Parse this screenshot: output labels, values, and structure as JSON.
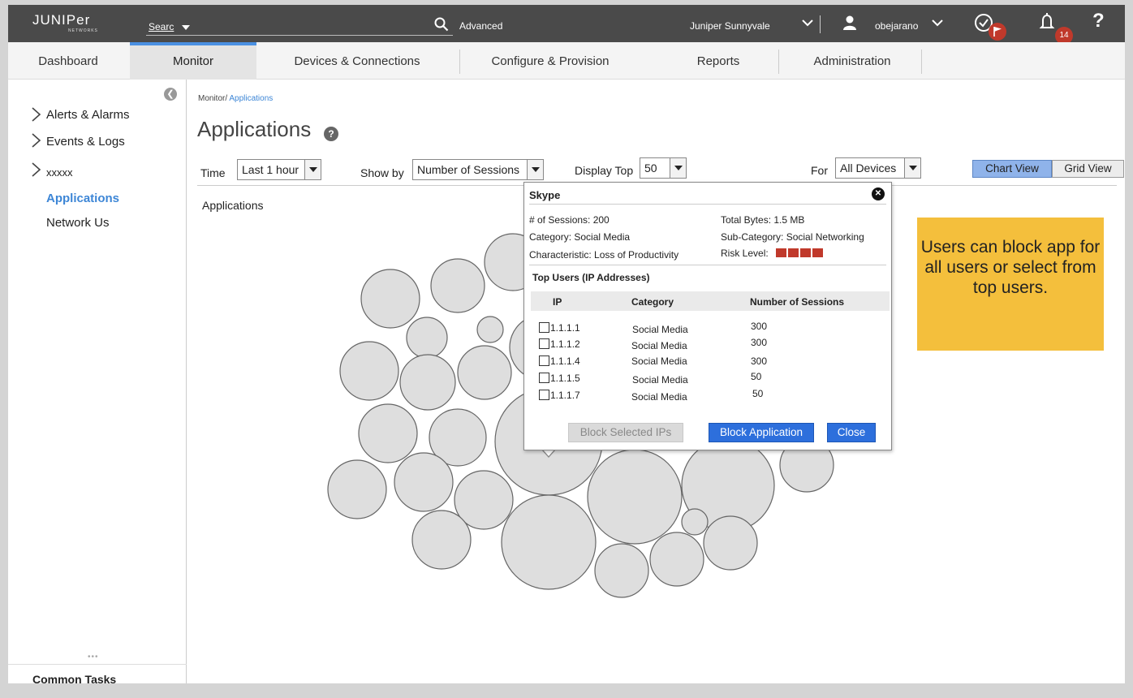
{
  "brand": {
    "logo_text": "JUNIPer",
    "logo_sub": "NETWORKS"
  },
  "topbar": {
    "search_label": "Searc",
    "advanced_label": "Advanced",
    "location": "Juniper Sunnyvale",
    "username": "obejarano",
    "notifications_count": "14",
    "help_label": "?"
  },
  "nav": {
    "items": [
      {
        "label": "Dashboard"
      },
      {
        "label": "Monitor"
      },
      {
        "label": "Devices & Connections"
      },
      {
        "label": "Configure & Provision"
      },
      {
        "label": "Reports"
      },
      {
        "label": "Administration"
      }
    ],
    "active": "Monitor"
  },
  "sidebar": {
    "items": [
      {
        "label": "Alerts & Alarms"
      },
      {
        "label": "Events & Logs"
      },
      {
        "label": "xxxxx"
      },
      {
        "label": "Applications"
      },
      {
        "label": "Network Us"
      }
    ],
    "common_tasks": "Common Tasks"
  },
  "main": {
    "breadcrumb_root": "Monitor/",
    "breadcrumb_current": "Applications",
    "title": "Applications",
    "apps_label": "Applications",
    "filters": {
      "time_label": "Time",
      "time_value": "Last 1 hour",
      "showby_label": "Show by",
      "showby_value": "Number of Sessions",
      "top_label": "Display Top",
      "top_value": "50",
      "for_label": "For",
      "for_value": "All Devices"
    },
    "chart_view": "Chart View",
    "grid_view": "Grid View"
  },
  "popup": {
    "title": "Skype",
    "sessions": "# of Sessions: 200",
    "total_bytes": "Total Bytes: 1.5 MB",
    "category": "Category: Social Media",
    "sub_category": "Sub-Category: Social Networking",
    "characteristic": "Characteristic: Loss of Productivity",
    "risk_label": "Risk Level:",
    "risk_level": 4,
    "top_users_title": "Top Users (IP Addresses)",
    "columns": {
      "ip": "IP",
      "category": "Category",
      "sessions": "Number of Sessions"
    },
    "users": [
      {
        "ip": "1.1.1.1",
        "category": "Social Media",
        "sessions": "300"
      },
      {
        "ip": "1.1.1.2",
        "category": "Social Media",
        "sessions": "300"
      },
      {
        "ip": "1.1.1.4",
        "category": "Social Media",
        "sessions": "300"
      },
      {
        "ip": "1.1.1.5",
        "category": "Social Media",
        "sessions": "50"
      },
      {
        "ip": "1.1.1.7",
        "category": "Social Media",
        "sessions": "50"
      }
    ],
    "block_selected": "Block Selected IPs",
    "block_application": "Block Application",
    "close": "Close"
  },
  "note": {
    "text": "Users can block app for all users or select from top users."
  },
  "colors": {
    "accent": "#3d86d6",
    "primary_button": "#2d6fdc",
    "risk": "#c0392b",
    "note": "#f4bf3c"
  }
}
